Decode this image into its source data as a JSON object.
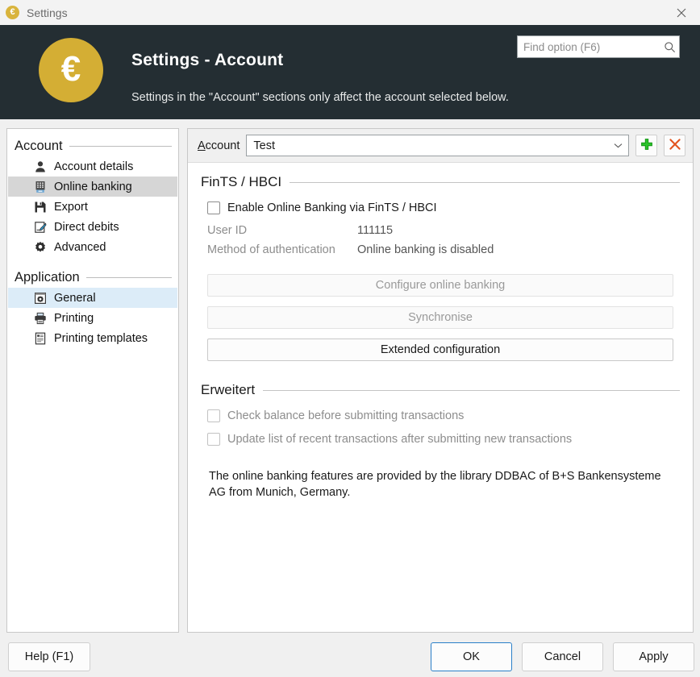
{
  "window": {
    "title": "Settings",
    "icon": "euro-coin-icon",
    "close_icon": "close-icon"
  },
  "header": {
    "logo_glyph": "€",
    "title": "Settings - Account",
    "subtitle": "Settings in the \"Account\" sections only affect the account selected below.",
    "search": {
      "placeholder": "Find option (F6)",
      "value": "",
      "icon": "search-icon"
    },
    "bg_color": "#242e33",
    "logo_color": "#d4ae34"
  },
  "sidebar": {
    "groups": [
      {
        "label": "Account",
        "items": [
          {
            "label": "Account details",
            "icon": "user-icon",
            "state": "normal"
          },
          {
            "label": "Online banking",
            "icon": "card-reader-icon",
            "state": "selected-gray"
          },
          {
            "label": "Export",
            "icon": "floppy-disk-icon",
            "state": "normal"
          },
          {
            "label": "Direct debits",
            "icon": "document-pencil-icon",
            "state": "normal"
          },
          {
            "label": "Advanced",
            "icon": "gear-icon",
            "state": "normal"
          }
        ]
      },
      {
        "label": "Application",
        "items": [
          {
            "label": "General",
            "icon": "window-gear-icon",
            "state": "selected-blue"
          },
          {
            "label": "Printing",
            "icon": "printer-icon",
            "state": "normal"
          },
          {
            "label": "Printing templates",
            "icon": "document-lines-icon",
            "state": "normal"
          }
        ]
      }
    ]
  },
  "account_bar": {
    "label_prefix": "A",
    "label_rest": "ccount",
    "selected": "Test",
    "chevron_icon": "chevron-down-icon",
    "add_icon": "plus-icon",
    "delete_icon": "x-icon",
    "add_color": "#2bc32b",
    "delete_color": "#e3541f"
  },
  "fints": {
    "section_title": "FinTS / HBCI",
    "enable_label": "Enable Online Banking via FinTS / HBCI",
    "enable_checked": false,
    "fields": [
      {
        "key": "User ID",
        "value": "111115"
      },
      {
        "key": "Method of authentication",
        "value": "Online banking is disabled"
      }
    ],
    "buttons": [
      {
        "label": "Configure online banking",
        "enabled": false
      },
      {
        "label": "Synchronise",
        "enabled": false
      },
      {
        "label": "Extended configuration",
        "enabled": true
      }
    ]
  },
  "erweitert": {
    "section_title": "Erweitert",
    "checkboxes": [
      {
        "label": "Check balance before submitting transactions",
        "checked": false,
        "enabled": false
      },
      {
        "label": "Update list of recent transactions after submitting new transactions",
        "checked": false,
        "enabled": false
      }
    ]
  },
  "info_text": "The online banking features are provided by the library DDBAC of B+S Bankensysteme AG from Munich, Germany.",
  "footer": {
    "help": "Help (F1)",
    "ok": "OK",
    "cancel": "Cancel",
    "apply": "Apply",
    "focus_color": "#2a7fc9"
  }
}
